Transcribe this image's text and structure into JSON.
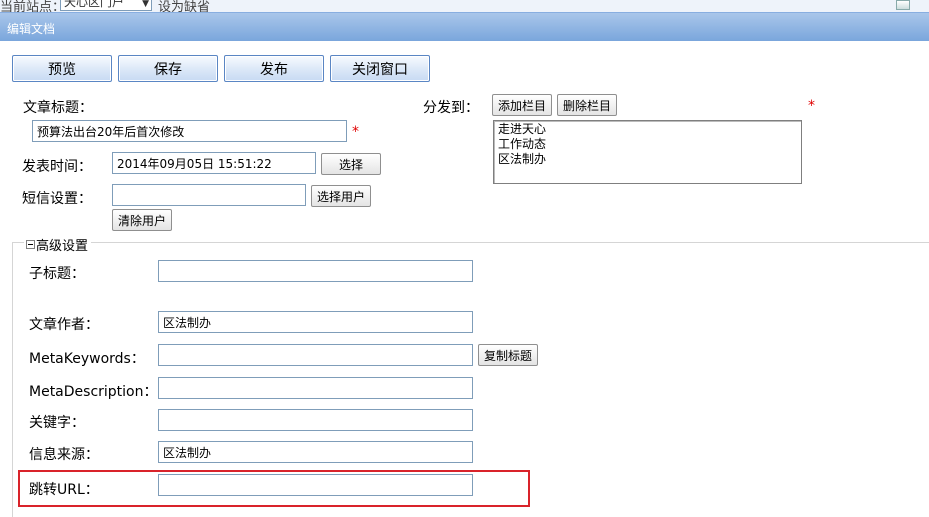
{
  "topbar": {
    "current_site_label": "当前站点：",
    "site_value": "天心区门户",
    "set_default": "设为缺省"
  },
  "window": {
    "title": "编辑文档"
  },
  "toolbar": {
    "preview": "预览",
    "save": "保存",
    "publish": "发布",
    "close_window": "关闭窗口"
  },
  "form": {
    "title_label": "文章标题：",
    "title_value": "预算法出台20年后首次修改",
    "publish_time_label": "发表时间：",
    "publish_time_value": "2014年09月05日 15:51:22",
    "select_btn": "选择",
    "sms_label": "短信设置：",
    "sms_value": "",
    "select_user_btn": "选择用户",
    "clear_user_btn": "清除用户",
    "distribute_label": "分发到：",
    "add_column_btn": "添加栏目",
    "delete_column_btn": "删除栏目",
    "columns": [
      "走进天心",
      "工作动态",
      "区法制办"
    ],
    "required_mark": "*"
  },
  "advanced": {
    "legend": "高级设置",
    "subtitle_label": "子标题：",
    "subtitle_value": "",
    "author_label": "文章作者：",
    "author_value": "区法制办",
    "keywords_label": "MetaKeywords：",
    "keywords_value": "",
    "copy_title_btn": "复制标题",
    "description_label": "MetaDescription：",
    "description_value": "",
    "keyword_label": "关键字：",
    "keyword_value": "",
    "source_label": "信息来源：",
    "source_value": "区法制办",
    "redirect_label": "跳转URL：",
    "redirect_value": ""
  },
  "colors": {
    "title_bar": "#7aa6dc",
    "highlight": "#d9232a",
    "required": "#e00000"
  }
}
